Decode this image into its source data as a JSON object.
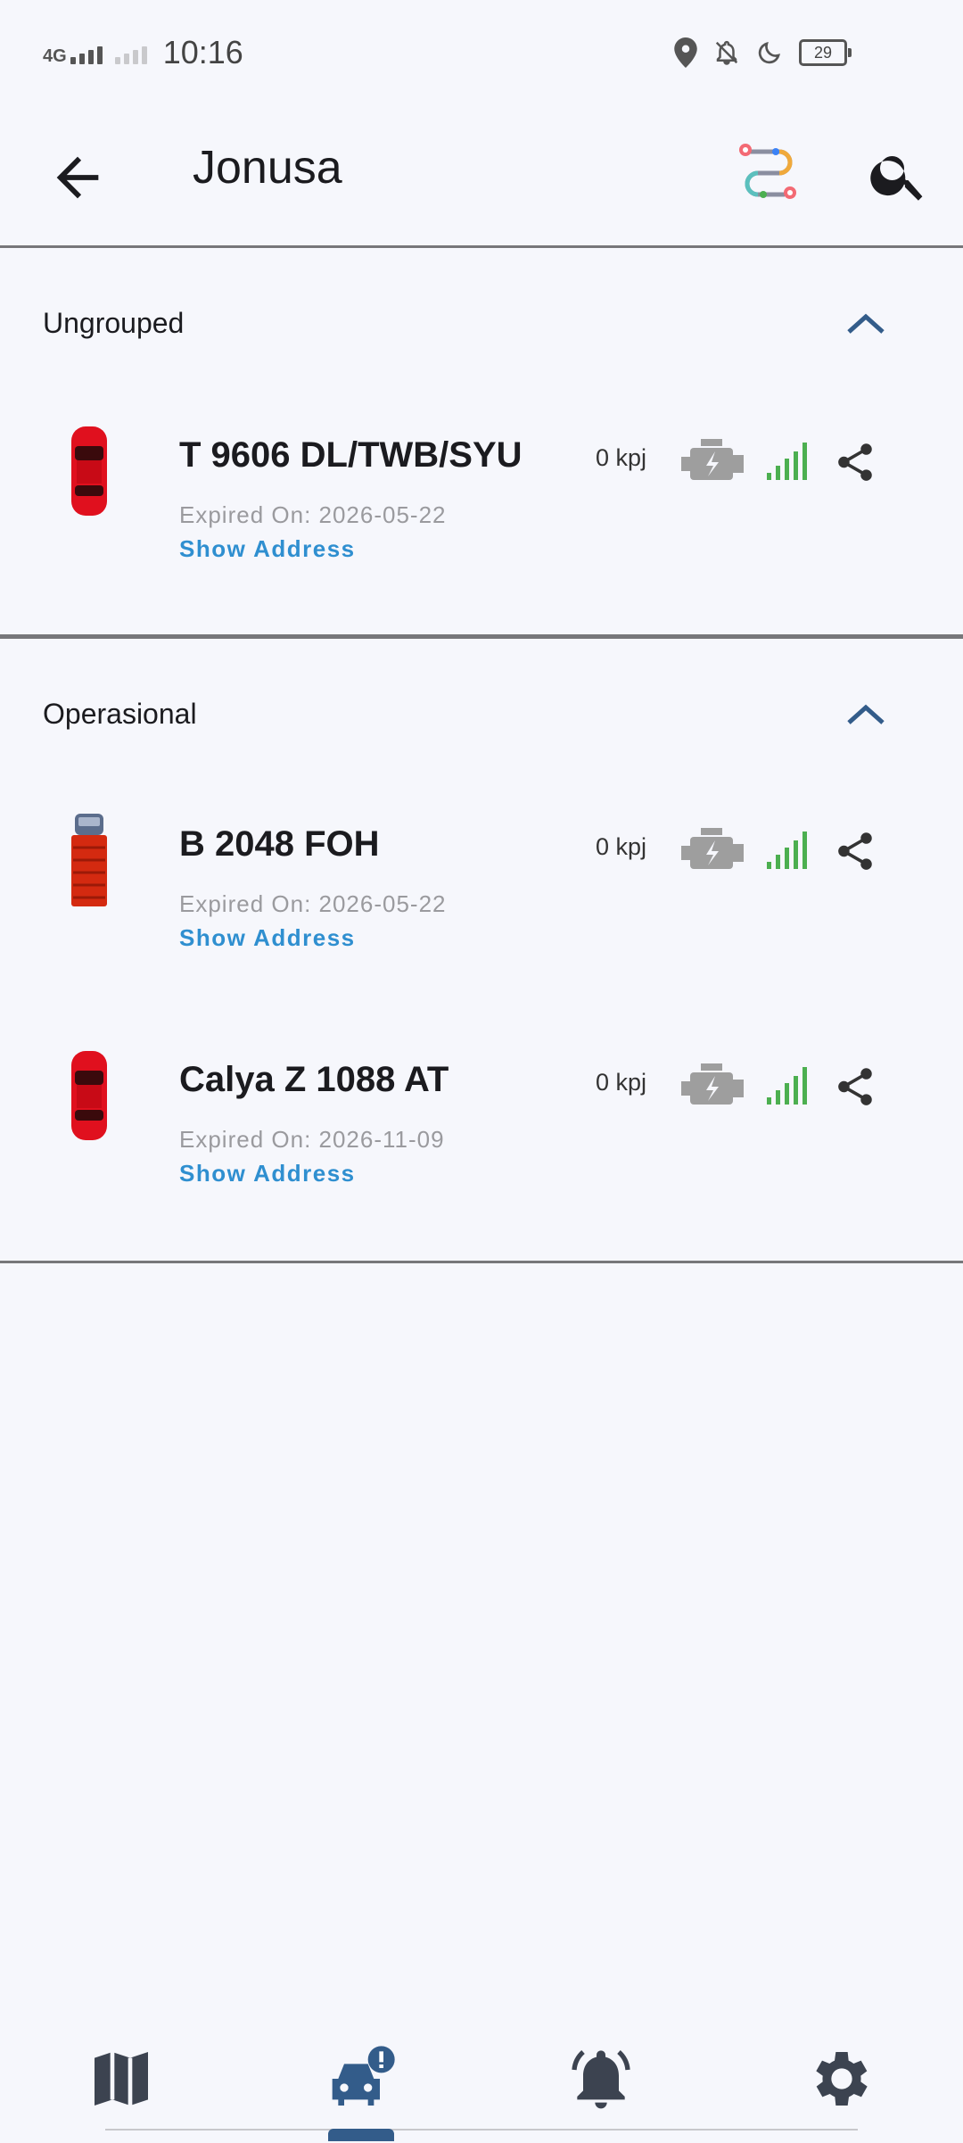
{
  "status_bar": {
    "network": "4G",
    "time": "10:16",
    "battery": "29",
    "icons": [
      "location-icon",
      "bell-off-icon",
      "moon-icon"
    ]
  },
  "app_bar": {
    "title": "Jonusa",
    "icons": [
      "back-arrow-icon",
      "route-icon",
      "search-icon"
    ]
  },
  "groups": [
    {
      "name": "Ungrouped",
      "vehicles": [
        {
          "name": "T 9606 DL/TWB/SYU",
          "expired": "Expired On: 2026-05-22",
          "address_link": "Show Address",
          "speed": "0 kpj",
          "type": "car"
        }
      ]
    },
    {
      "name": "Operasional",
      "vehicles": [
        {
          "name": "B 2048 FOH",
          "expired": "Expired On: 2026-05-22",
          "address_link": "Show Address",
          "speed": "0 kpj",
          "type": "truck"
        },
        {
          "name": "Calya Z 1088 AT",
          "expired": "Expired On: 2026-11-09",
          "address_link": "Show Address",
          "speed": "0 kpj",
          "type": "car"
        }
      ]
    }
  ],
  "bottom_nav": {
    "items": [
      "map-icon",
      "vehicle-alert-icon",
      "notification-bell-icon",
      "settings-gear-icon"
    ],
    "active_index": 1
  },
  "colors": {
    "background": "#f6f7fc",
    "accent": "#335c8a",
    "link": "#2f8fd0",
    "signal": "#4caf50",
    "engine": "#9e9e9e",
    "vehicle_red": "#e0101e"
  }
}
